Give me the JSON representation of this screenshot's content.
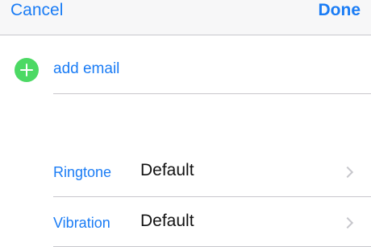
{
  "navbar": {
    "cancel_label": "Cancel",
    "done_label": "Done"
  },
  "add_email": {
    "label": "add email",
    "icon": "plus-circle-icon",
    "icon_color": "#4cd964"
  },
  "settings": [
    {
      "label": "Ringtone",
      "value": "Default"
    },
    {
      "label": "Vibration",
      "value": "Default"
    }
  ],
  "colors": {
    "accent": "#1a7cf5",
    "separator": "#c8c7cc",
    "navbar_bg": "#f7f7f8"
  }
}
